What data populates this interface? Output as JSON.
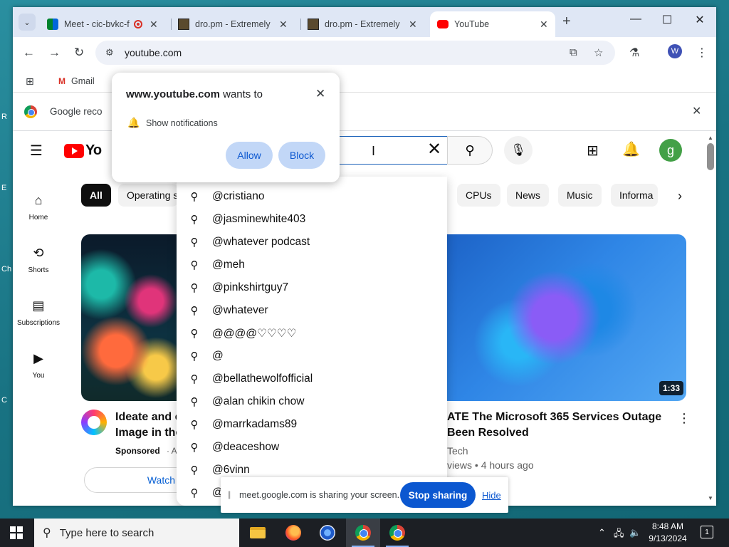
{
  "browser": {
    "tabs": [
      {
        "title": "Meet - cic-bvkc-f",
        "recording": true
      },
      {
        "title": "dro.pm - Extremely S"
      },
      {
        "title": "dro.pm - Extremely S"
      },
      {
        "title": "YouTube",
        "active": true
      }
    ],
    "address": "youtube.com",
    "profile_initial": "W",
    "bookmarks": {
      "gmail": "Gmail"
    },
    "infobar": {
      "text": "Google reco"
    }
  },
  "permission_popup": {
    "site": "www.youtube.com",
    "wants_to": "wants to",
    "request": "Show notifications",
    "allow": "Allow",
    "block": "Block"
  },
  "youtube": {
    "logo_text": "Yo",
    "avatar_initial": "g",
    "sidebar": [
      {
        "label": "Home",
        "icon": "home-icon"
      },
      {
        "label": "Shorts",
        "icon": "shorts-icon"
      },
      {
        "label": "Subscriptions",
        "icon": "subscriptions-icon"
      },
      {
        "label": "You",
        "icon": "you-icon"
      }
    ],
    "chips": [
      "All",
      "Operating s",
      "CPUs",
      "News",
      "Music",
      "Informa"
    ],
    "suggestions": [
      "@cristiano",
      "@jasminewhite403",
      "@whatever podcast",
      "@meh",
      "@pinkshirtguy7",
      "@whatever",
      "@@@@♡♡♡♡",
      "@",
      "@bellathewolfofficial",
      "@alan chikin chow",
      "@marrkadams89",
      "@deaceshow",
      "@6vinn",
      "@"
    ],
    "video_left": {
      "title_line1": "Ideate and c",
      "title_line2": "Image in the",
      "sponsored": "Sponsored",
      "ad_suffix": "· A",
      "watch": "Watch"
    },
    "video_right": {
      "title_line1": "ATE The Microsoft 365 Services Outage",
      "title_line2": "Been Resolved",
      "channel": "Tech",
      "meta": "views • 4 hours ago",
      "duration": "1:33"
    }
  },
  "screen_share": {
    "text": "meet.google.com is sharing your screen.",
    "stop": "Stop sharing",
    "hide": "Hide"
  },
  "taskbar": {
    "search_placeholder": "Type here to search",
    "time": "8:48 AM",
    "date": "9/13/2024",
    "notifications": "1"
  },
  "desktop_labels": [
    "R",
    "E",
    "Ch",
    "C"
  ]
}
